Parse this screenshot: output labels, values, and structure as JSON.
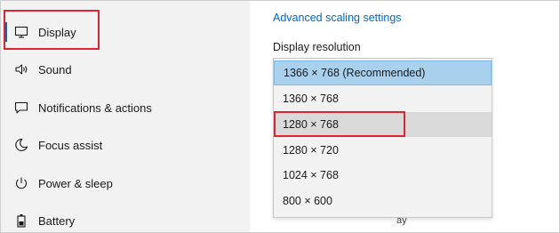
{
  "sidebar": {
    "items": [
      {
        "label": "Display",
        "icon": "monitor-icon",
        "active": true
      },
      {
        "label": "Sound",
        "icon": "speaker-icon"
      },
      {
        "label": "Notifications & actions",
        "icon": "message-icon"
      },
      {
        "label": "Focus assist",
        "icon": "moon-icon"
      },
      {
        "label": "Power & sleep",
        "icon": "power-icon"
      },
      {
        "label": "Battery",
        "icon": "battery-icon"
      }
    ]
  },
  "main": {
    "advanced_scaling_link": "Advanced scaling settings",
    "resolution_label": "Display resolution",
    "resolution_options": [
      "1366 × 768 (Recommended)",
      "1360 × 768",
      "1280 × 768",
      "1280 × 720",
      "1024 × 768",
      "800 × 600"
    ],
    "selected_option": "1366 × 768 (Recommended)",
    "highlighted_option": "1280 × 768",
    "trailing_partial_text": "ay"
  },
  "colors": {
    "accent": "#0067c0",
    "annotation_red": "#e0232e",
    "selected_bg": "#a9d1ee",
    "hover_bg": "#dadada"
  }
}
